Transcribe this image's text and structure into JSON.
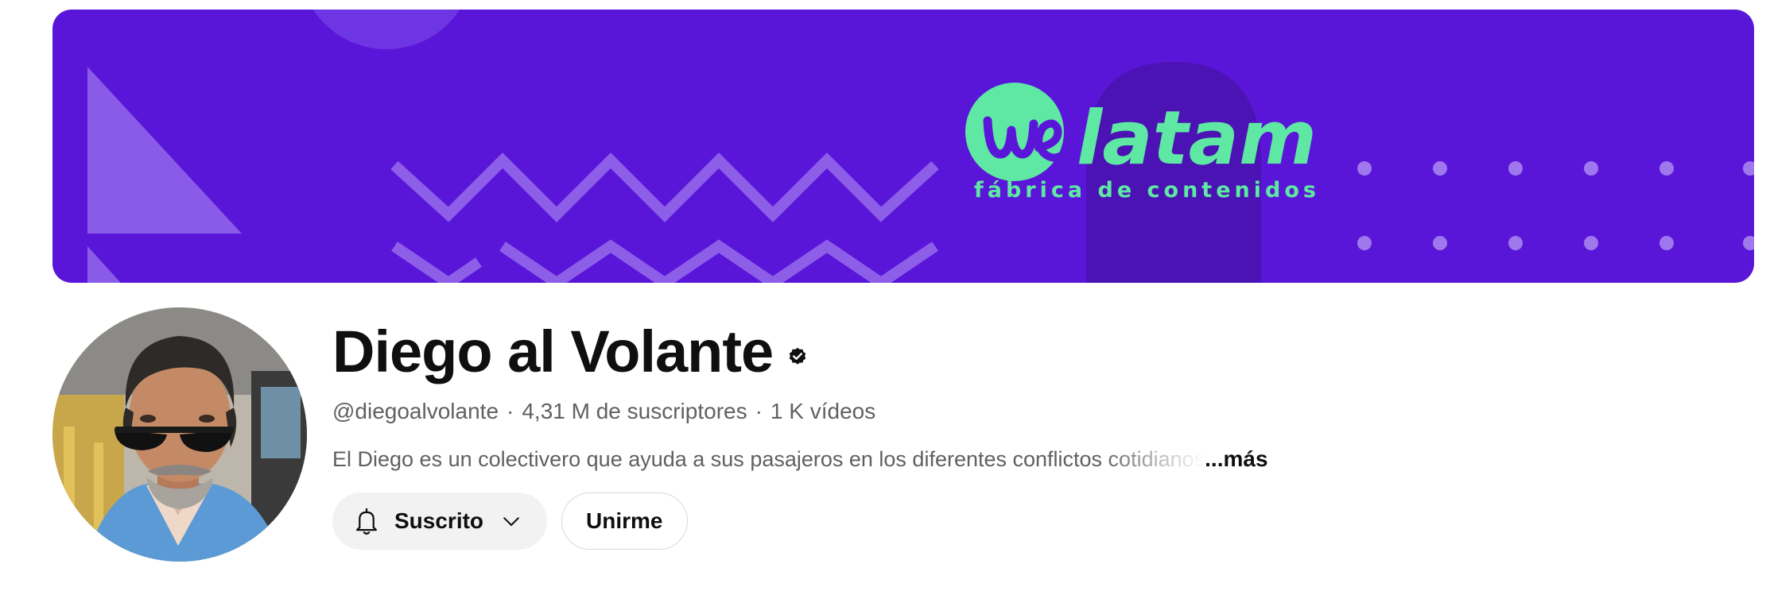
{
  "banner": {
    "logo_mark": "we",
    "logo_word": "latam",
    "tagline": "fábrica de contenidos",
    "colors": {
      "background": "#5a16d8",
      "logo_green": "#5ee8a3"
    }
  },
  "channel": {
    "name": "Diego al Volante",
    "verified_icon": "verified-check-icon",
    "handle": "@diegoalvolante",
    "subscribers": "4,31 M de suscriptores",
    "videos": "1 K vídeos",
    "separator": "·",
    "description": "El Diego es un colectivero que ayuda a sus pasajeros en los diferentes conflictos cotidianos",
    "more_label": "...más"
  },
  "actions": {
    "subscribed_label": "Suscrito",
    "subscribed_icon": "bell-icon",
    "subscribed_menu_icon": "chevron-down-icon",
    "join_label": "Unirme"
  }
}
